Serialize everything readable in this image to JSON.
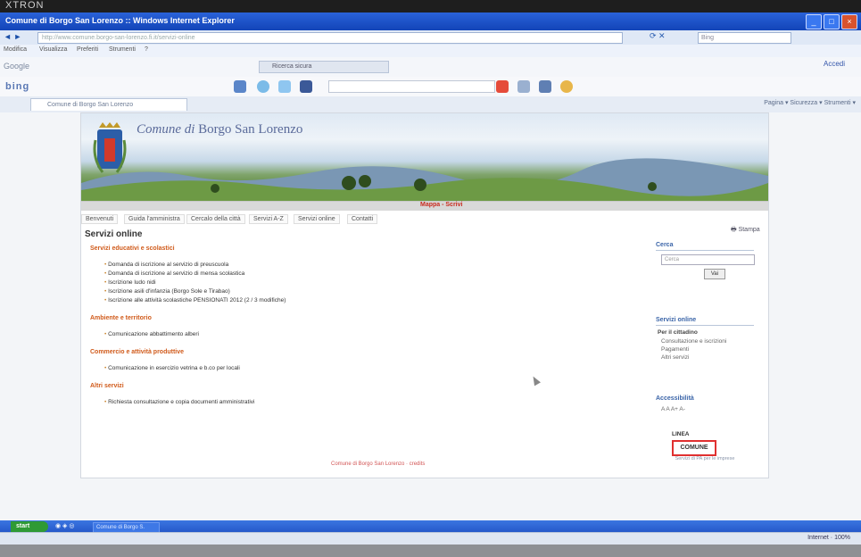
{
  "monitor": {
    "brand": "XTRON"
  },
  "browser": {
    "title": "Comune di Borgo San Lorenzo :: Windows Internet Explorer",
    "nav_arrows": "◄ ►",
    "address": "http://www.comune.borgo-san-lorenzo.fi.it/servizi-online",
    "search_placeholder": "Bing",
    "menu": [
      "Modifica",
      "Visualizza",
      "Preferiti",
      "Strumenti",
      "?"
    ],
    "toolbar_label": "Google",
    "toolbar_field": "Ricerca sicura",
    "toolbar_right": "Accedi",
    "bing_label": "bing",
    "tab_title": "Comune di Borgo San Lorenzo",
    "tab_tools": "Pagina ▾ Sicurezza ▾ Strumenti ▾"
  },
  "site": {
    "title_prefix": "Comune di",
    "title_name": "Borgo San Lorenzo",
    "strip_text": "Mappa - Scrivi",
    "strip_right": "",
    "tabs": [
      "Benvenuti",
      "Guida l'amministra",
      "Cercalo della città",
      "Servizi A-Z",
      "Servizi online",
      "Contatti"
    ],
    "section_title": "Servizi online",
    "print_label": "Stampa",
    "categories": [
      {
        "label": "Servizi educativi e scolastici",
        "items": [
          "Domanda di iscrizione al servizio di preuscuola",
          "Domanda di iscrizione al servizio di mensa scolastica",
          "Iscrizione ludo nidi",
          "Iscrizione asili d'infanzia (Borgo Sole e Tirabao)",
          "Iscrizione alle attività scolastiche PENSIONATI 2012 (2 / 3 modifiche)"
        ]
      },
      {
        "label": "Ambiente e territorio",
        "items": [
          "Comunicazione abbattimento alberi"
        ]
      },
      {
        "label": "Commercio e attività produttive",
        "items": [
          "Comunicazione in esercizio vetrina e b.co per locali"
        ]
      },
      {
        "label": "Altri servizi",
        "items": [
          "Richiesta consultazione e copia documenti amministrativi"
        ]
      }
    ],
    "footer_link": "Comune di Borgo San Lorenzo · credits",
    "sidebar": {
      "search_heading": "Cerca",
      "search_placeholder": "Cerca",
      "search_button": "Vai",
      "services_heading": "Servizi online",
      "services_sub": "Per il cittadino",
      "services_links": [
        "Consultazione e iscrizioni",
        "Pagamenti",
        "Altri servizi"
      ],
      "access_heading": "Accessibilità",
      "access_text": "A  A  A+ A-",
      "logo_top": "LINEA",
      "logo_main": "COMUNE",
      "logo_sub": "Servizi di PA per le imprese"
    }
  },
  "taskbar": {
    "start": "start",
    "task": "Comune di Borgo S."
  },
  "status": {
    "zone": "Internet",
    "zoom": "100%"
  }
}
